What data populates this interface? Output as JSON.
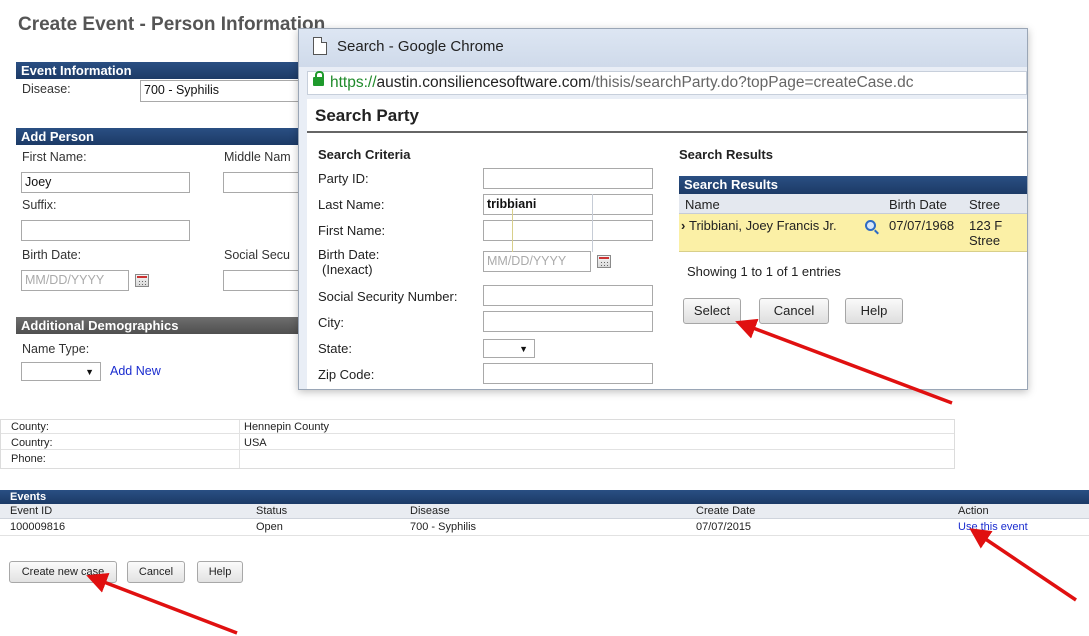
{
  "background": {
    "page_title": "Create Event - Person Information",
    "event_info": {
      "header": "Event Information",
      "disease_label": "Disease:",
      "disease_value": "700 - Syphilis"
    },
    "add_person": {
      "header": "Add Person",
      "first_name_label": "First Name:",
      "first_name_value": "Joey",
      "middle_name_label": "Middle Nam",
      "suffix_label": "Suffix:",
      "birth_date_label": "Birth Date:",
      "birth_date_placeholder": "MM/DD/YYYY",
      "ssn_label": "Social Secu"
    },
    "additional_demographics": {
      "header": "Additional Demographics",
      "name_type_label": "Name Type:",
      "add_new_link": "Add New"
    }
  },
  "chrome_window": {
    "title": "Search - Google Chrome",
    "url_https": "https://",
    "url_host": "austin.consiliencesoftware.com",
    "url_path": "/thisis/searchParty.do?topPage=createCase.dc",
    "page_heading": "Search Party",
    "criteria": {
      "header": "Search Criteria",
      "party_id_label": "Party ID:",
      "party_id_value": "",
      "last_name_label": "Last Name:",
      "last_name_value": "tribbiani",
      "first_name_label": "First Name:",
      "first_name_value": "",
      "birth_date_label": "Birth Date:",
      "inexact_link": "(Inexact)",
      "birth_date_placeholder": "MM/DD/YYYY",
      "ssn_label": "Social Security Number:",
      "city_label": "City:",
      "state_label": "State:",
      "zip_label": "Zip Code:"
    },
    "results": {
      "outer_header": "Search Results",
      "table_header": "Search Results",
      "columns": [
        "Name",
        "Birth Date",
        "Stree"
      ],
      "row": {
        "name": "Tribbiani, Joey Francis Jr.",
        "birth_date": "07/07/1968",
        "street_line1": "123 F",
        "street_line2": "Stree"
      },
      "showing": "Showing 1 to 1 of 1 entries",
      "buttons": {
        "select": "Select",
        "cancel": "Cancel",
        "help": "Help"
      }
    }
  },
  "person_details": [
    {
      "label": "County:",
      "value": "Hennepin County"
    },
    {
      "label": "Country:",
      "value": "USA"
    },
    {
      "label": "Phone:",
      "value": ""
    }
  ],
  "events": {
    "header": "Events",
    "columns": [
      "Event ID",
      "Status",
      "Disease",
      "Create Date",
      "Action"
    ],
    "rows": [
      {
        "event_id": "100009816",
        "status": "Open",
        "disease": "700 - Syphilis",
        "create_date": "07/07/2015",
        "action": "Use this event"
      }
    ]
  },
  "bottom_buttons": {
    "create_new_case": "Create new case",
    "cancel": "Cancel",
    "help": "Help"
  },
  "colors": {
    "header_blue": "#1c3a66",
    "result_row_highlight": "#fbf0a6",
    "arrow_red": "#e01010",
    "link_blue": "#1a2ccf"
  }
}
